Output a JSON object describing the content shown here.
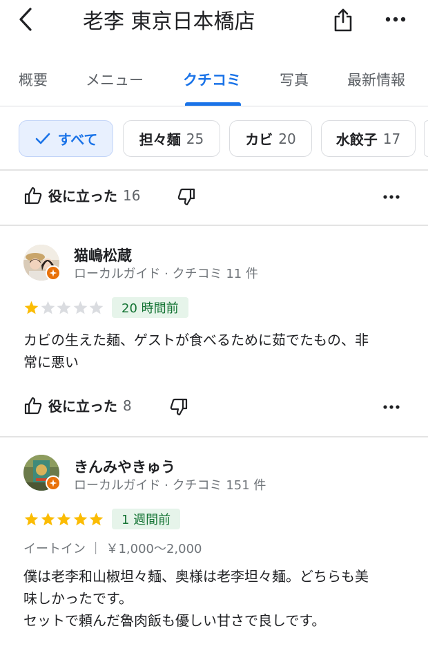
{
  "header": {
    "back_icon": "chevron-left-icon",
    "title": "老李 東京日本橋店",
    "share_icon": "share-icon",
    "more_icon": "more-horizontal-icon"
  },
  "tabs": [
    {
      "label": "概要",
      "active": false
    },
    {
      "label": "メニュー",
      "active": false
    },
    {
      "label": "クチコミ",
      "active": true
    },
    {
      "label": "写真",
      "active": false
    },
    {
      "label": "最新情報",
      "active": false
    }
  ],
  "chips": [
    {
      "label": "すべて",
      "count": "",
      "selected": true,
      "icon": "check-icon"
    },
    {
      "label": "担々麺",
      "count": "25",
      "selected": false
    },
    {
      "label": "カビ",
      "count": "20",
      "selected": false
    },
    {
      "label": "水餃子",
      "count": "17",
      "selected": false
    }
  ],
  "top_action": {
    "helpful_label": "役に立った",
    "helpful_count": "16"
  },
  "reviews": [
    {
      "name": "猫嶋松蔵",
      "meta": "ローカルガイド · クチコミ 11 件",
      "rating": 1,
      "time": "20 時間前",
      "dine_info": "",
      "text": "カビの生えた麺、ゲストが食べるために茹でたもの、非\n常に悪い",
      "helpful_label": "役に立った",
      "helpful_count": "8"
    },
    {
      "name": "きんみやきゅう",
      "meta": "ローカルガイド · クチコミ 151 件",
      "rating": 5,
      "time": "1 週間前",
      "dine_info": "イートイン ｜ ￥1,000〜2,000",
      "text": "僕は老李和山椒坦々麺、奥様は老李坦々麺。どちらも美\n味しかったです。\nセットで頼んだ魯肉飯も優しい甘さで良しです。",
      "helpful_label": "",
      "helpful_count": ""
    }
  ],
  "colors": {
    "accent": "#1a73e8",
    "star": "#fbbc04",
    "star_empty": "#dadce0",
    "time_badge_bg": "#e6f4ea",
    "time_badge_fg": "#137333",
    "guide_badge": "#e8710a"
  }
}
